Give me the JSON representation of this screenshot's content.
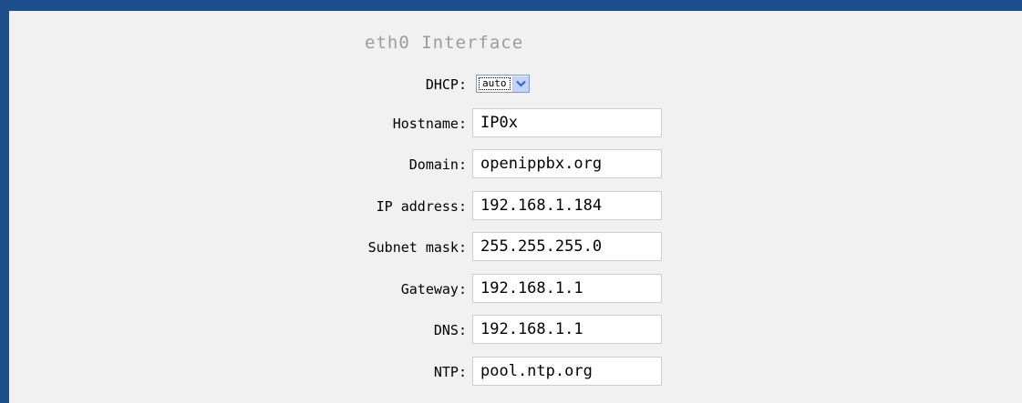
{
  "section": {
    "title": "eth0 Interface"
  },
  "dhcp": {
    "label": "DHCP:",
    "value": "auto"
  },
  "fields": [
    {
      "label": "Hostname:",
      "value": "IP0x"
    },
    {
      "label": "Domain:",
      "value": "openippbx.org"
    },
    {
      "label": "IP address:",
      "value": "192.168.1.184"
    },
    {
      "label": "Subnet mask:",
      "value": "255.255.255.0"
    },
    {
      "label": "Gateway:",
      "value": "192.168.1.1"
    },
    {
      "label": "DNS:",
      "value": "192.168.1.1"
    },
    {
      "label": "NTP:",
      "value": "pool.ntp.org"
    }
  ],
  "colors": {
    "frame": "#1f4e8c",
    "panel": "#f1f1f1",
    "title": "#9c9c9c",
    "dropdown_arrow": "#3a64c9"
  },
  "icons": {
    "dropdown": "chevron-down-icon"
  }
}
